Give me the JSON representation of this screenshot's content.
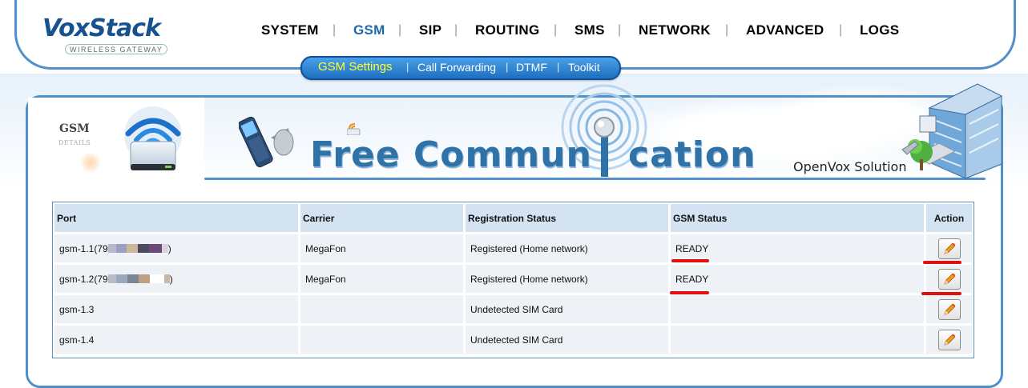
{
  "brand": {
    "name": "VoxStack",
    "tagline": "WIRELESS GATEWAY"
  },
  "main_nav": [
    {
      "label": "SYSTEM",
      "active": false
    },
    {
      "label": "GSM",
      "active": true
    },
    {
      "label": "SIP",
      "active": false
    },
    {
      "label": "ROUTING",
      "active": false
    },
    {
      "label": "SMS",
      "active": false
    },
    {
      "label": "NETWORK",
      "active": false
    },
    {
      "label": "ADVANCED",
      "active": false
    },
    {
      "label": "LOGS",
      "active": false
    }
  ],
  "sub_nav": [
    {
      "label": "GSM Settings",
      "active": true
    },
    {
      "label": "Call Forwarding",
      "active": false
    },
    {
      "label": "DTMF",
      "active": false
    },
    {
      "label": "Toolkit",
      "active": false
    }
  ],
  "page_tab": {
    "title": "GSM",
    "subtitle": "DETAILS"
  },
  "banner": {
    "slogan_part1": "Free Commun",
    "slogan_part2": "cation",
    "company": "OpenVox Solution"
  },
  "table": {
    "headers": {
      "port": "Port",
      "carrier": "Carrier",
      "registration": "Registration Status",
      "gsm_status": "GSM Status",
      "action": "Action"
    },
    "rows": [
      {
        "port_prefix": "gsm-1.1(79",
        "port_suffix": ")",
        "carrier": "MegaFon",
        "registration": "Registered (Home network)",
        "gsm_status": "READY",
        "action_icon": "pencil-icon"
      },
      {
        "port_prefix": "gsm-1.2(79",
        "port_suffix": ")",
        "carrier": "MegaFon",
        "registration": "Registered (Home network)",
        "gsm_status": "READY",
        "action_icon": "pencil-icon"
      },
      {
        "port_prefix": "gsm-1.3",
        "port_suffix": "",
        "carrier": "",
        "registration": "Undetected SIM Card",
        "gsm_status": "",
        "action_icon": "pencil-icon"
      },
      {
        "port_prefix": "gsm-1.4",
        "port_suffix": "",
        "carrier": "",
        "registration": "Undetected SIM Card",
        "gsm_status": "",
        "action_icon": "pencil-icon"
      }
    ]
  },
  "colors": {
    "frame_blue": "#4f8fcb",
    "active_nav": "#1e68b0",
    "subnav_active": "#ffff33",
    "header_cell": "#d3e3f2",
    "body_cell": "#eef2f7",
    "annotation_red": "#e01010"
  }
}
